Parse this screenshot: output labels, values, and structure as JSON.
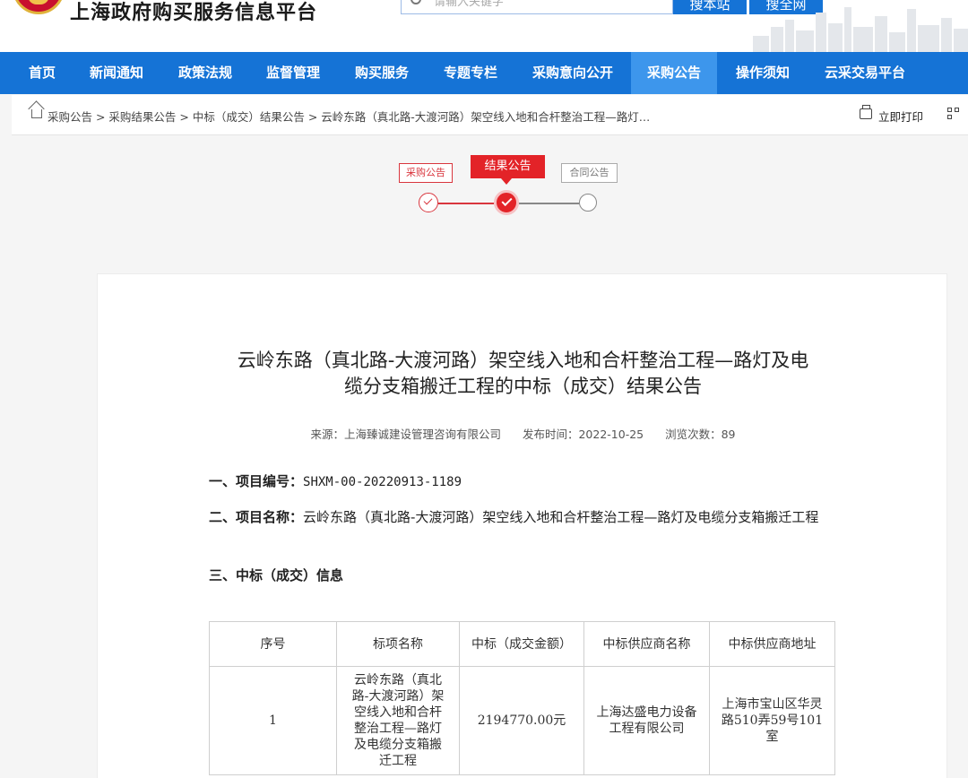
{
  "header": {
    "site_title": "上海政府购买服务信息平台",
    "search_placeholder": "请输入关键字",
    "search_buttons": [
      "搜本站",
      "搜全网"
    ]
  },
  "nav": {
    "items": [
      "首页",
      "新闻通知",
      "政策法规",
      "监督管理",
      "购买服务",
      "专题专栏",
      "采购意向公开",
      "采购公告",
      "操作须知",
      "云采交易平台"
    ],
    "active_index": 7
  },
  "breadcrumb": {
    "text": "采购公告 > 采购结果公告 > 中标（成交）结果公告 > 云岭东路（真北路-大渡河路）架空线入地和合杆整治工程—路灯…",
    "print_label": "立即打印"
  },
  "steps": {
    "labels": [
      "采购公告",
      "结果公告",
      "合同公告"
    ],
    "current_index": 1
  },
  "article": {
    "title_line1": "云岭东路（真北路-大渡河路）架空线入地和合杆整治工程—路灯及电",
    "title_line2": "缆分支箱搬迁工程的中标（成交）结果公告",
    "meta_source": "来源：上海臻诚建设管理咨询有限公司",
    "meta_date": "发布时间：2022-10-25",
    "meta_views": "浏览次数：89",
    "sec1_label": "一、项目编号：",
    "sec1_value": "SHXM-00-20220913-1189",
    "sec2_label": "二、项目名称：",
    "sec2_value": "云岭东路（真北路-大渡河路）架空线入地和合杆整治工程—路灯及电缆分支箱搬迁工程",
    "sec3_label": "三、中标（成交）信息"
  },
  "table": {
    "headers": [
      "序号",
      "标项名称",
      "中标（成交金额）",
      "中标供应商名称",
      "中标供应商地址"
    ],
    "rows": [
      [
        "1",
        "云岭东路（真北路-大渡河路）架空线入地和合杆整治工程—路灯及电缆分支箱搬迁工程",
        "2194770.00元",
        "上海达盛电力设备工程有限公司",
        "上海市宝山区华灵路510弄59号101室"
      ]
    ]
  },
  "colors": {
    "primary_blue": "#1573d6",
    "active_nav": "#3d96ec",
    "accent_red": "#e32328"
  }
}
